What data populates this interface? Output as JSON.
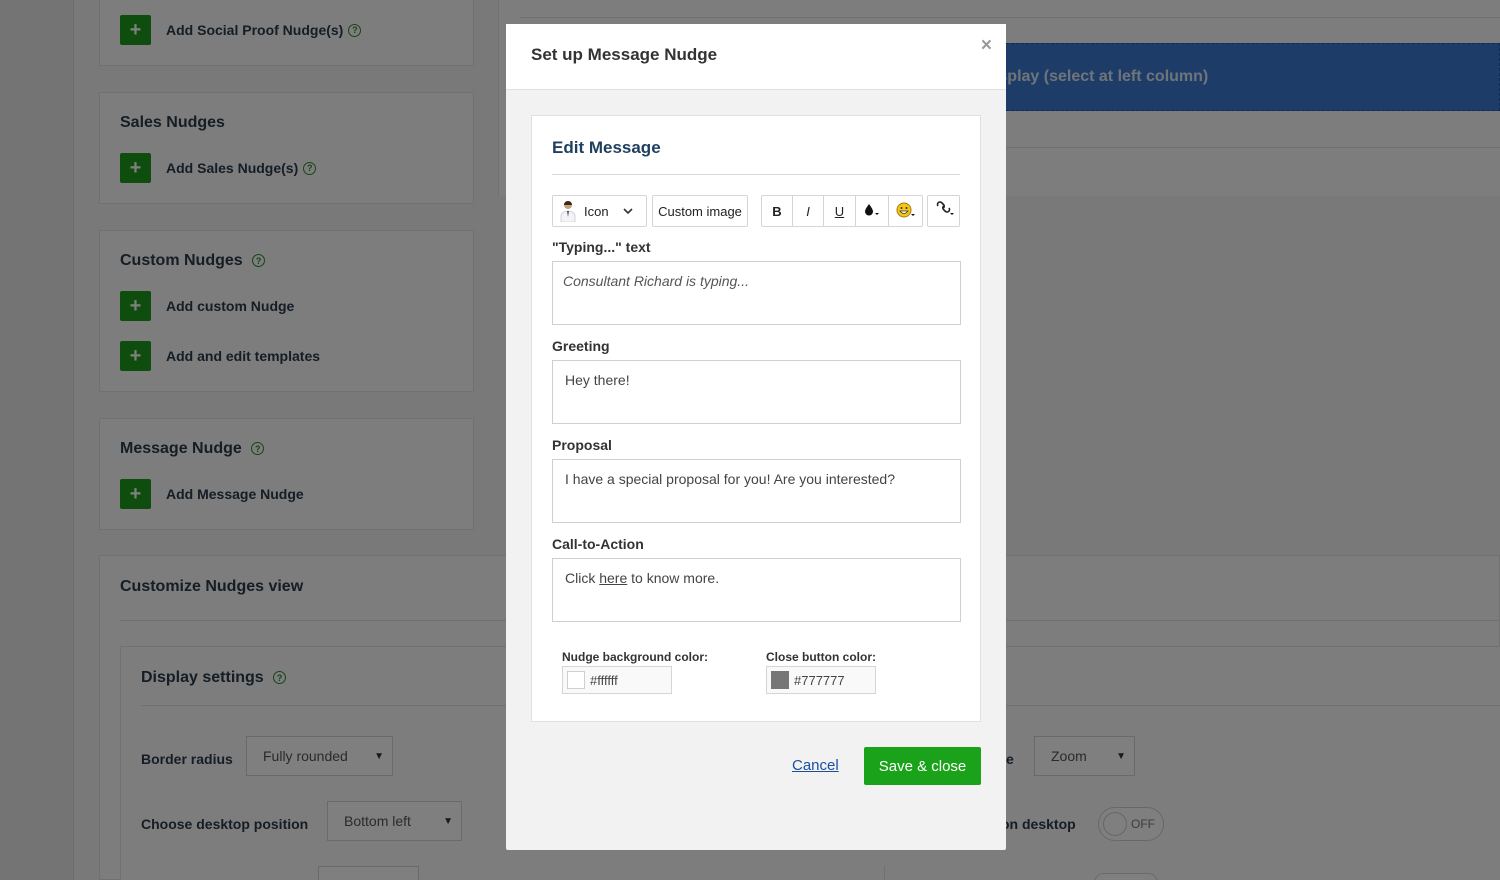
{
  "background": {
    "social_proof_add_label": "Add Social Proof Nudge(s)",
    "sales": {
      "title": "Sales Nudges",
      "add_label": "Add Sales Nudge(s)"
    },
    "custom": {
      "title": "Custom Nudges",
      "add_custom_label": "Add custom Nudge",
      "add_templates_label": "Add and edit templates"
    },
    "message": {
      "title": "Message Nudge",
      "add_label": "Add Message Nudge"
    },
    "banner_text": "dge to display (select at left column)",
    "customize": {
      "title": "Customize Nudges view",
      "display_title": "Display settings",
      "border_radius_label": "Border radius",
      "border_radius_value": "Fully rounded",
      "desktop_position_label": "Choose desktop position",
      "desktop_position_value": "Bottom left",
      "right_label_partial": "e",
      "right_select_value": "Zoom",
      "right_toggle_label_partial": "on desktop",
      "toggle_state": "OFF"
    },
    "help_glyph": "?",
    "plus_glyph": "+",
    "caret_glyph": "▼"
  },
  "modal": {
    "title": "Set up Message Nudge",
    "close_glyph": "×",
    "card_title": "Edit Message",
    "toolbar": {
      "icon_label": "Icon",
      "custom_image_label": "Custom image",
      "bold": "B",
      "italic": "I",
      "underline": "U"
    },
    "fields": {
      "typing_label": "\"Typing...\" text",
      "typing_value": "Consultant Richard is typing...",
      "greeting_label": "Greeting",
      "greeting_value": "Hey there!",
      "proposal_label": "Proposal",
      "proposal_value": "I have a special proposal for you! Are you interested?",
      "cta_label": "Call-to-Action",
      "cta_prefix": "Click ",
      "cta_link": "here",
      "cta_suffix": " to know more."
    },
    "colors": {
      "bg_label": "Nudge background color:",
      "bg_value": "#ffffff",
      "close_label": "Close button color:",
      "close_value": "#777777"
    },
    "cancel_label": "Cancel",
    "save_label": "Save & close"
  }
}
